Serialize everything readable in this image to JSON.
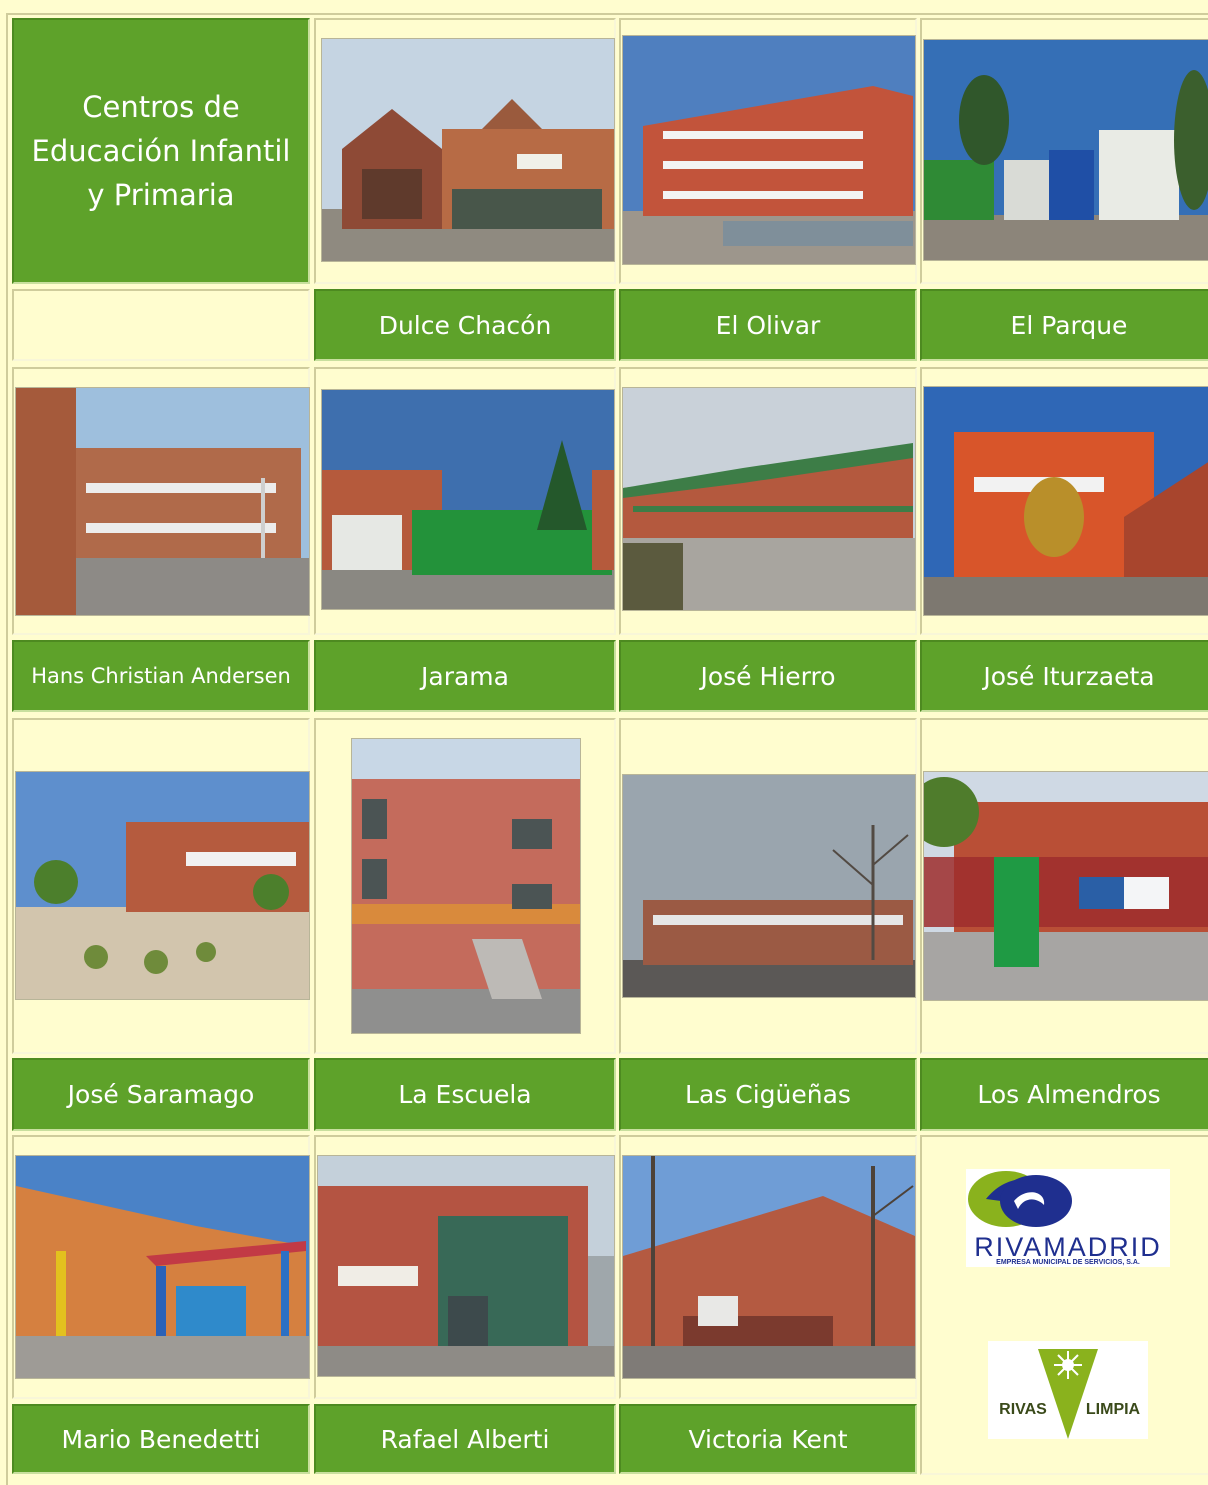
{
  "title": {
    "line1": "Centros de",
    "line2": "Educación Infantil",
    "line3": "y Primaria"
  },
  "schools": [
    {
      "label": "Dulce Chacón"
    },
    {
      "label": "El Olivar"
    },
    {
      "label": "El Parque"
    },
    {
      "label": "Hans Christian Andersen"
    },
    {
      "label": "Jarama"
    },
    {
      "label": "José Hierro"
    },
    {
      "label": "José Iturzaeta"
    },
    {
      "label": "José Saramago"
    },
    {
      "label": "La Escuela"
    },
    {
      "label": "Las Cigüeñas"
    },
    {
      "label": "Los Almendros"
    },
    {
      "label": "Mario Benedetti"
    },
    {
      "label": "Rafael Alberti"
    },
    {
      "label": "Victoria Kent"
    }
  ],
  "sponsors": {
    "rivamadrid_name": "RIVAMADRID",
    "rivamadrid_sub": "EMPRESA MUNICIPAL DE SERVICIOS, S.A.",
    "rivas_left": "RIVAS",
    "rivas_right": "LIMPIA"
  },
  "colors": {
    "accent_green": "#5ea22a",
    "background": "#fffdcf",
    "rivamadrid_blue": "#1f2f8f",
    "rivamadrid_green": "#8ab21d"
  }
}
